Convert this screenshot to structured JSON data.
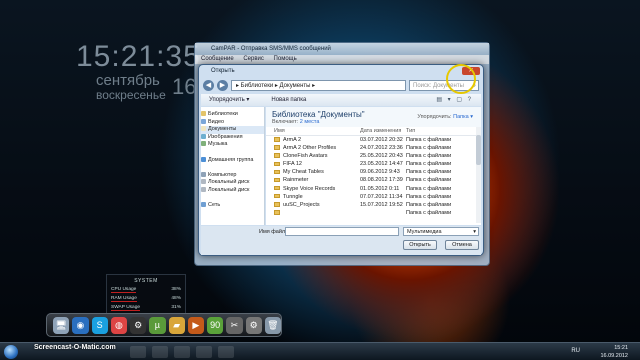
{
  "desktop": {
    "clock_time": "15:21:35",
    "clock_month": "сентябрь",
    "clock_weekday": "воскресенье",
    "clock_day": "16"
  },
  "bg_window": {
    "title": "CamPAR - Отправка SMS/MMS сообщений",
    "menu": [
      "Сообщение",
      "Сервис",
      "Помощь"
    ]
  },
  "dialog": {
    "title": "Открыть",
    "close": "✕",
    "back": "◀",
    "forward": "▶",
    "breadcrumb": "▸ Библиотеки ▸ Документы ▸",
    "search_placeholder": "Поиск: Документы",
    "toolbar_left": "Упорядочить ▾",
    "toolbar_new_folder": "Новая папка",
    "toolbar_right": "▤ ▾ ▢ ?",
    "sidebar": [
      {
        "label": "Библиотеки",
        "color": "#e3c46a"
      },
      {
        "label": "Видео",
        "color": "#7aa6d8"
      },
      {
        "label": "Документы",
        "color": "#f0e6c0"
      },
      {
        "label": "Изображения",
        "color": "#6fb0d0"
      },
      {
        "label": "Музыка",
        "color": "#7fb07a"
      },
      {
        "label": "",
        "color": ""
      },
      {
        "label": "Домашняя группа",
        "color": "#4c8fd6"
      },
      {
        "label": "",
        "color": ""
      },
      {
        "label": "Компьютер",
        "color": "#8fa3b8"
      },
      {
        "label": "Локальный диск",
        "color": "#b0b8c2"
      },
      {
        "label": "Локальный диск",
        "color": "#b0b8c2"
      },
      {
        "label": "",
        "color": ""
      },
      {
        "label": "Сеть",
        "color": "#6f9fd3"
      }
    ],
    "library_title": "Библиотека \"Документы\"",
    "library_includes": "Включает:",
    "library_places": "2 места",
    "sort_label": "Упорядочить:",
    "sort_value": "Папка ▾",
    "columns": {
      "name": "Имя",
      "date": "Дата изменения",
      "type": "Тип"
    },
    "files": [
      {
        "name": "ArmA 2",
        "date": "03.07.2012 20:32",
        "type": "Папка с файлами"
      },
      {
        "name": "ArmA 2 Other Profiles",
        "date": "24.07.2012 23:36",
        "type": "Папка с файлами"
      },
      {
        "name": "CloneFish Avatars",
        "date": "25.05.2012 20:43",
        "type": "Папка с файлами"
      },
      {
        "name": "FIFA 12",
        "date": "23.05.2012 14:47",
        "type": "Папка с файлами"
      },
      {
        "name": "My Cheat Tables",
        "date": "09.06.2012 9:43",
        "type": "Папка с файлами"
      },
      {
        "name": "Rainmeter",
        "date": "08.08.2012 17:39",
        "type": "Папка с файлами"
      },
      {
        "name": "Skype Voice Records",
        "date": "01.05.2012 0:11",
        "type": "Папка с файлами"
      },
      {
        "name": "Tunngle",
        "date": "07.07.2012 11:34",
        "type": "Папка с файлами"
      },
      {
        "name": "uuSC_Projects",
        "date": "15.07.2012 19:52",
        "type": "Папка с файлами"
      },
      {
        "name": "",
        "date": "",
        "type": "Папка с файлами"
      }
    ],
    "filename_label": "Имя файла:",
    "filename_value": "",
    "filetype_value": "Мультимедиа",
    "open_button": "Открыть",
    "cancel_button": "Отмена"
  },
  "sysmon": {
    "title": "SYSTEM",
    "rows": [
      {
        "label": "CPU Usage",
        "value": "38%"
      },
      {
        "label": "RAM Usage",
        "value": "48%"
      },
      {
        "label": "SWAP Usage",
        "value": "31%"
      }
    ]
  },
  "dock": {
    "icons": [
      {
        "name": "computer-icon",
        "glyph": "🖥",
        "color": "#8fa3b8"
      },
      {
        "name": "globe-icon",
        "glyph": "◉",
        "color": "#2a6fbf"
      },
      {
        "name": "skype-icon",
        "glyph": "S",
        "color": "#1aa0e0"
      },
      {
        "name": "chrome-icon",
        "glyph": "◍",
        "color": "#d44"
      },
      {
        "name": "steam-icon",
        "glyph": "⚙",
        "color": "#333"
      },
      {
        "name": "utorrent-icon",
        "glyph": "µ",
        "color": "#5a9a3a"
      },
      {
        "name": "folder-icon",
        "glyph": "▰",
        "color": "#d9a63a"
      },
      {
        "name": "media-icon",
        "glyph": "▶",
        "color": "#c45a1a"
      },
      {
        "name": "badge-icon",
        "glyph": "90",
        "color": "#5aa23a"
      },
      {
        "name": "tools-icon",
        "glyph": "✂",
        "color": "#666"
      },
      {
        "name": "settings-icon",
        "glyph": "⚙",
        "color": "#777"
      },
      {
        "name": "recycle-bin-icon",
        "glyph": "🗑",
        "color": "#8899aa"
      }
    ]
  },
  "taskbar": {
    "watermark": "Screencast-O-Matic.com",
    "lang": "RU",
    "time": "15:21",
    "date": "16.09.2012"
  }
}
